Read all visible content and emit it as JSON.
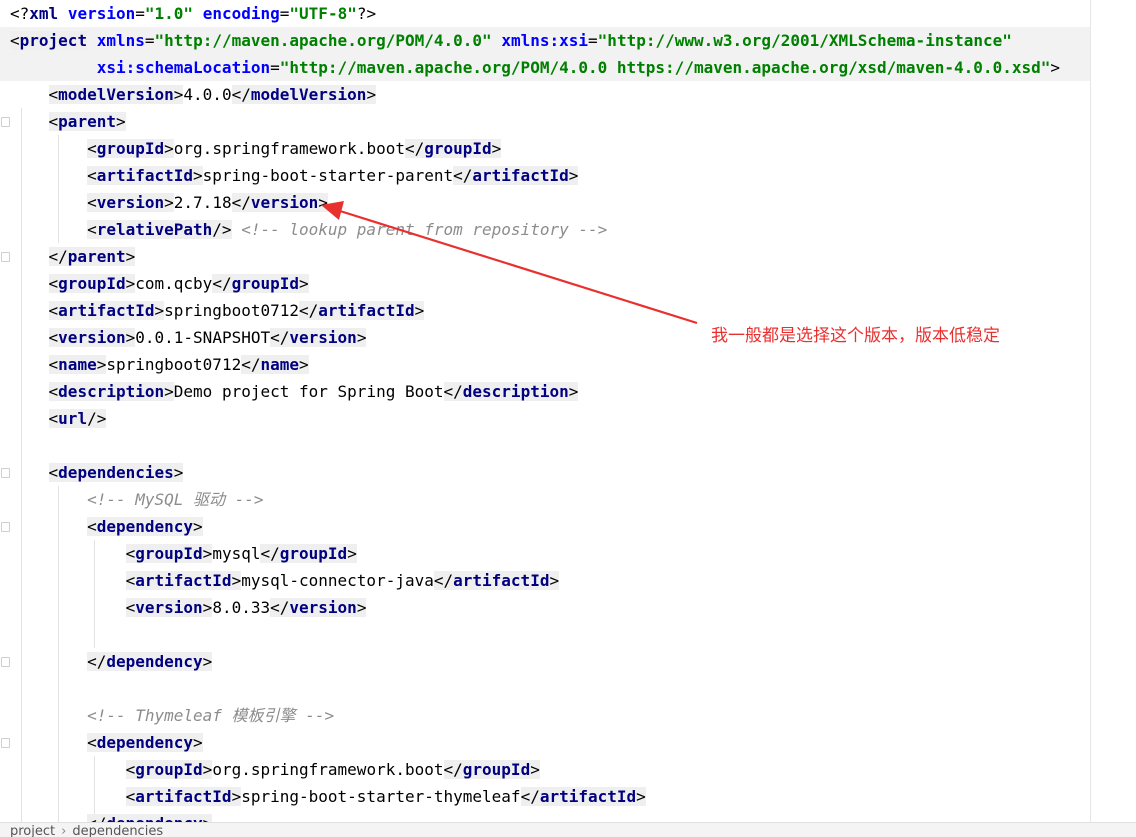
{
  "editor": {
    "lines": [
      {
        "id": 1,
        "content": "<?xml version=\"1.0\" encoding=\"UTF-8\"?>"
      },
      {
        "id": 2,
        "content": "<project xmlns=\"http://maven.apache.org/POM/4.0.0\" xmlns:xsi=\"http://www.w3.org/2001/XMLSchema-instance\""
      },
      {
        "id": 3,
        "content": "         xsi:schemaLocation=\"http://maven.apache.org/POM/4.0.0 https://maven.apache.org/xsd/maven-4.0.0.xsd\">"
      },
      {
        "id": 4,
        "content": "    <modelVersion>4.0.0</modelVersion>"
      },
      {
        "id": 5,
        "content": "    <parent>"
      },
      {
        "id": 6,
        "content": "        <groupId>org.springframework.boot</groupId>"
      },
      {
        "id": 7,
        "content": "        <artifactId>spring-boot-starter-parent</artifactId>"
      },
      {
        "id": 8,
        "content": "        <version>2.7.18</version>"
      },
      {
        "id": 9,
        "content": "        <relativePath/> <!-- lookup parent from repository -->"
      },
      {
        "id": 10,
        "content": "    </parent>"
      },
      {
        "id": 11,
        "content": "    <groupId>com.qcby</groupId>"
      },
      {
        "id": 12,
        "content": "    <artifactId>springboot0712</artifactId>"
      },
      {
        "id": 13,
        "content": "    <version>0.0.1-SNAPSHOT</version>"
      },
      {
        "id": 14,
        "content": "    <name>springboot0712</name>"
      },
      {
        "id": 15,
        "content": "    <description>Demo project for Spring Boot</description>"
      },
      {
        "id": 16,
        "content": "    <url/>"
      },
      {
        "id": 17,
        "content": ""
      },
      {
        "id": 18,
        "content": "    <dependencies>"
      },
      {
        "id": 19,
        "content": "        <!-- MySQL 驱动 -->"
      },
      {
        "id": 20,
        "content": "        <dependency>"
      },
      {
        "id": 21,
        "content": "            <groupId>mysql</groupId>"
      },
      {
        "id": 22,
        "content": "            <artifactId>mysql-connector-java</artifactId>"
      },
      {
        "id": 23,
        "content": "            <version>8.0.33</version>"
      },
      {
        "id": 24,
        "content": ""
      },
      {
        "id": 25,
        "content": "        </dependency>"
      },
      {
        "id": 26,
        "content": ""
      },
      {
        "id": 27,
        "content": "        <!-- Thymeleaf 模板引擎 -->"
      },
      {
        "id": 28,
        "content": "        <dependency>"
      },
      {
        "id": 29,
        "content": "            <groupId>org.springframework.boot</groupId>"
      },
      {
        "id": 30,
        "content": "            <artifactId>spring-boot-starter-thymeleaf</artifactId>"
      },
      {
        "id": 31,
        "content": "        </dependency>"
      }
    ]
  },
  "annotation": {
    "text": "我一般都是选择这个版本，版本低稳定",
    "color": "#e8312f"
  },
  "breadcrumb": {
    "items": [
      "project",
      "dependencies"
    ]
  },
  "colors": {
    "tag": "#000080",
    "attribute": "#0000ff",
    "string": "#008000",
    "comment": "#8c8c8c",
    "current_line": "#f2f2f2"
  }
}
